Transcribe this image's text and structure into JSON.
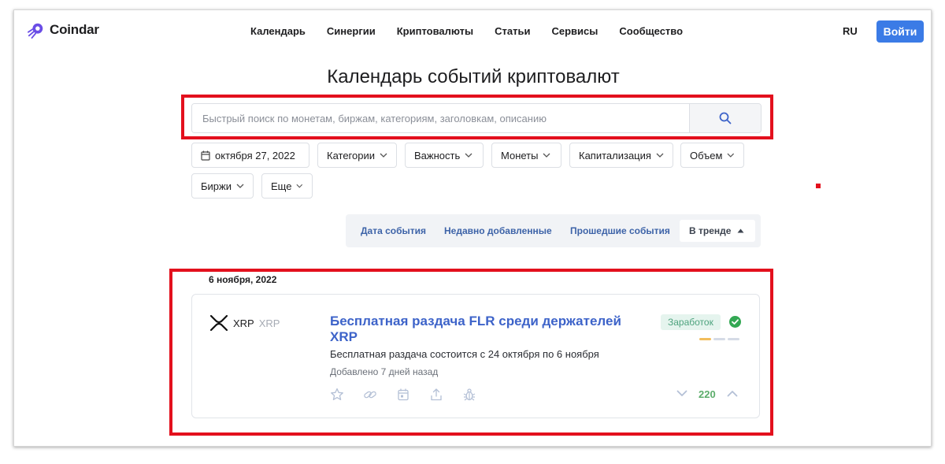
{
  "app": {
    "name": "Coindar"
  },
  "nav": [
    {
      "label": "Календарь"
    },
    {
      "label": "Синергии"
    },
    {
      "label": "Криптовалюты"
    },
    {
      "label": "Статьи"
    },
    {
      "label": "Сервисы"
    },
    {
      "label": "Сообщество"
    }
  ],
  "header": {
    "lang": "RU",
    "login_label": "Войти"
  },
  "page": {
    "title": "Календарь событий криптовалют"
  },
  "search": {
    "placeholder": "Быстрый поиск по монетам, биржам, категориям, заголовкам, описанию",
    "value": ""
  },
  "filters": {
    "date": "октября 27, 2022",
    "categories": "Категории",
    "importance": "Важность",
    "coins": "Монеты",
    "capitalization": "Капитализация",
    "volume": "Объем",
    "exchanges": "Биржи",
    "more": "Еще"
  },
  "sort": {
    "event_date": "Дата события",
    "recently_added": "Недавно добавленные",
    "past_events": "Прошедшие события",
    "trending": "В тренде"
  },
  "events_group": {
    "date": "6 ноября, 2022",
    "event": {
      "coin_symbol": "XRP",
      "coin_ticker": "XRP",
      "title": "Бесплатная раздача FLR среди держателей XRP",
      "description": "Бесплатная раздача состоится с 24 октября по 6 ноября",
      "added": "Добавлено 7 дней назад",
      "category_badge": "Заработок",
      "votes": "220",
      "importance_level": 1,
      "importance_max": 3,
      "colors": {
        "importance_on": "#f2bd5c",
        "importance_off": "#d5dbe6",
        "verified": "#33a853",
        "votes": "#5cad6b"
      }
    }
  },
  "colors": {
    "accent": "#3b7be6",
    "highlight": "#e3101d",
    "link": "#3d63c9"
  }
}
